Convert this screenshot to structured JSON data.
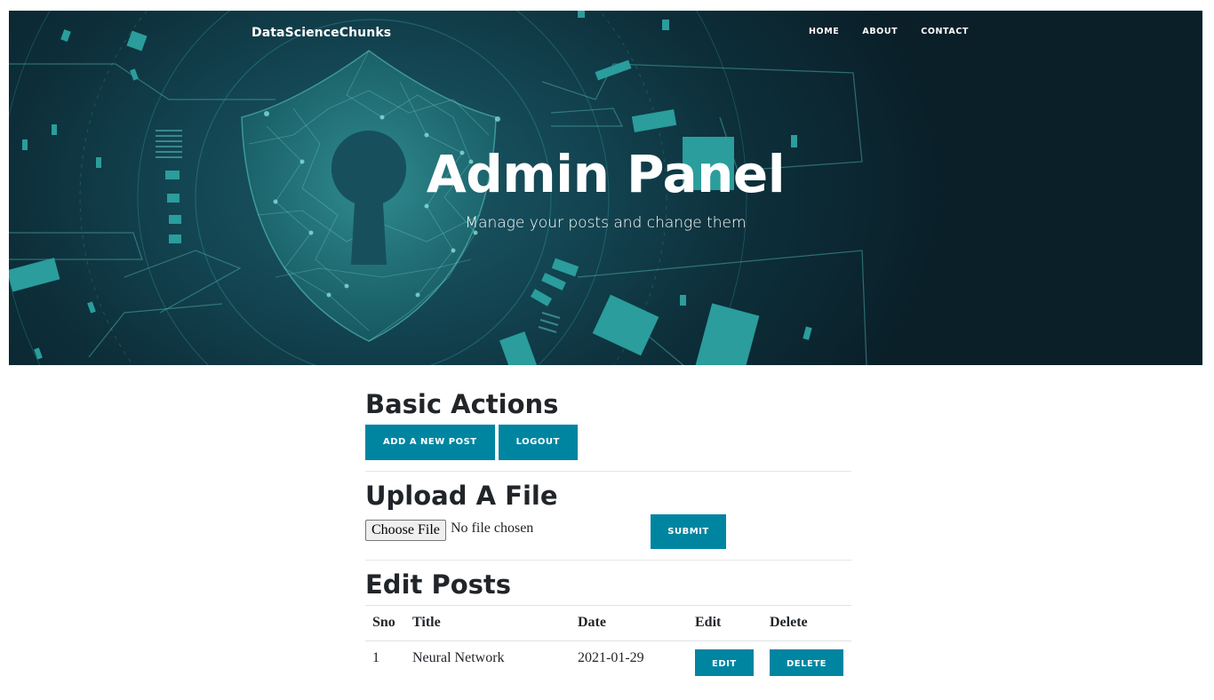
{
  "nav": {
    "brand": "DataScienceChunks",
    "links": [
      "HOME",
      "ABOUT",
      "CONTACT"
    ]
  },
  "hero": {
    "title": "Admin Panel",
    "subtitle": "Manage your posts and change them"
  },
  "basic_actions": {
    "title": "Basic Actions",
    "add_post_label": "ADD A NEW POST",
    "logout_label": "LOGOUT"
  },
  "upload": {
    "title": "Upload A File",
    "choose_file_label": "Choose File",
    "file_status": "No file chosen",
    "submit_label": "SUBMIT"
  },
  "edit_posts": {
    "title": "Edit Posts",
    "columns": [
      "Sno",
      "Title",
      "Date",
      "Edit",
      "Delete"
    ],
    "rows": [
      {
        "sno": "1",
        "title": "Neural Network",
        "date": "2021-01-29",
        "edit_label": "EDIT",
        "delete_label": "DELETE"
      }
    ]
  },
  "colors": {
    "accent": "#0085a1",
    "hero_bg": "#134552",
    "hero_art": "#2a9d9c"
  }
}
